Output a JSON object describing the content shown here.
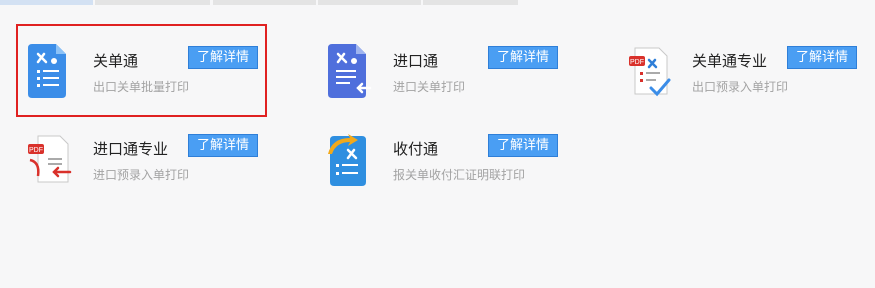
{
  "colors": {
    "page_bg": "#f7f7f8",
    "button_bg": "#4a9ef3",
    "highlight": "#e02121",
    "desc_text": "#a3a3a3"
  },
  "products": [
    {
      "title": "关单通",
      "desc": "出口关单批量打印",
      "button": "了解详情",
      "icon": "document-tools-icon"
    },
    {
      "title": "进口通",
      "desc": "进口关单打印",
      "button": "了解详情",
      "icon": "document-import-icon"
    },
    {
      "title": "关单通专业",
      "desc": "出口预录入单打印",
      "button": "了解详情",
      "icon": "pdf-checklist-icon"
    },
    {
      "title": "进口通专业",
      "desc": "进口预录入单打印",
      "button": "了解详情",
      "icon": "pdf-import-icon"
    },
    {
      "title": "收付通",
      "desc": "报关单收付汇证明联打印",
      "button": "了解详情",
      "icon": "payment-document-icon"
    }
  ]
}
